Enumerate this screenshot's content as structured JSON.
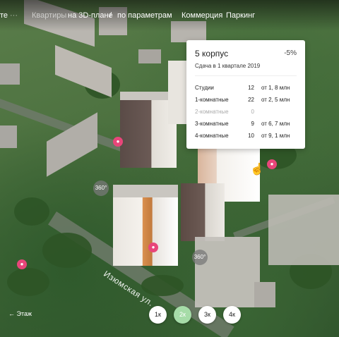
{
  "nav": {
    "left_text": "те",
    "dots": "···",
    "apartments_label": "Квартиры",
    "on_3d": "на 3D-плане",
    "separator": "/",
    "by_params": "по параметрам",
    "commerce": "Коммерция",
    "parking": "Паркинг"
  },
  "popup": {
    "title": "5 корпус",
    "discount": "-5%",
    "completion": "Сдача в 1 квартале 2019",
    "rows": [
      {
        "type": "Студии",
        "count": "12",
        "price": "от 1, 8 млн",
        "available": true
      },
      {
        "type": "1-комнатные",
        "count": "22",
        "price": "от 2, 5 млн",
        "available": true
      },
      {
        "type": "2-комнатные",
        "count": "0",
        "price": "",
        "available": false
      },
      {
        "type": "3-комнатные",
        "count": "9",
        "price": "от 6, 7 млн",
        "available": true
      },
      {
        "type": "4-комнатные",
        "count": "10",
        "price": "от 9, 1 млн",
        "available": true
      }
    ]
  },
  "map": {
    "street": "Изюмская ул.",
    "pano_a": "360°",
    "pano_b": "360°"
  },
  "floor": {
    "label": "Этаж",
    "buttons": [
      "1к",
      "2к",
      "3к",
      "4к"
    ],
    "active": "2к"
  },
  "colors": {
    "pin": "#e8467a",
    "active_button": "#a6dca8"
  }
}
